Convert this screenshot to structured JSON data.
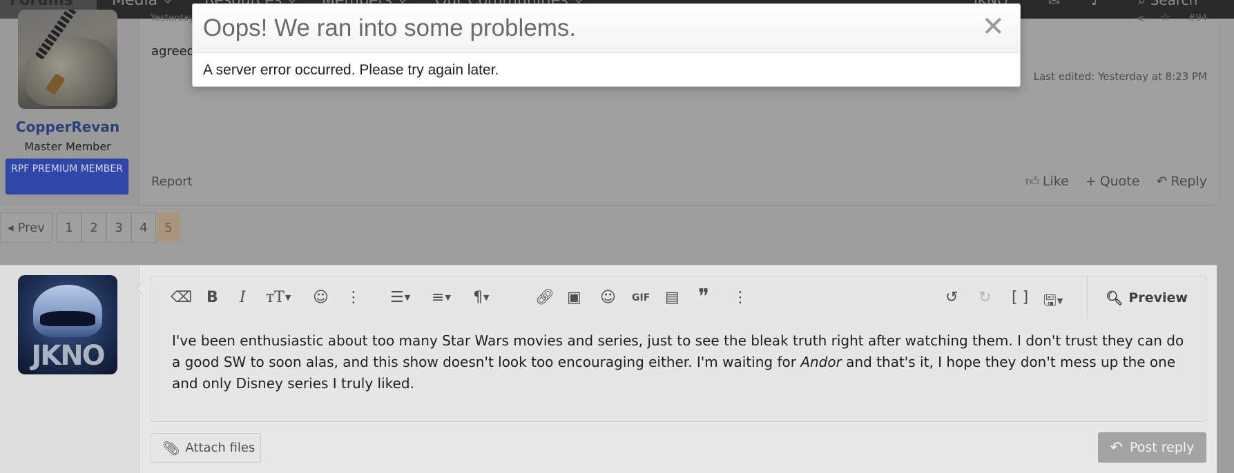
{
  "nav": {
    "tabs": [
      "Forums",
      "Media",
      "Resources",
      "Members",
      "Our Communities"
    ],
    "user": "JKNO",
    "search_label": "Search"
  },
  "post": {
    "username": "CopperRevan",
    "user_title": "Master Member",
    "badge": "RPF PREMIUM MEMBER",
    "timestamp": "Yesterday",
    "post_number": "#94",
    "content": "agreed",
    "last_edited": "Last edited: Yesterday at 8:23 PM",
    "report": "Report",
    "actions": {
      "like": "Like",
      "quote": "Quote",
      "reply": "Reply"
    }
  },
  "pagination": {
    "prev": "Prev",
    "pages": [
      "1",
      "2",
      "3",
      "4",
      "5"
    ],
    "current": "5"
  },
  "reply": {
    "avatar_text": "JKNO",
    "text_before": "I've been enthusiastic about too many Star Wars movies and series, just to see the bleak truth right after watching them. I don't trust they can do a good SW to soon alas, and this show doesn't look too encouraging either. I'm waiting for ",
    "text_italic": "Andor",
    "text_after": " and that's it, I hope they don't mess up the one and only Disney series I truly liked.",
    "preview_label": "Preview",
    "attach_label": "Attach files",
    "post_label": "Post reply",
    "toolbar_icons": [
      "eraser-icon",
      "bold-icon",
      "italic-icon",
      "text-size-icon",
      "color-palette-icon",
      "more-options-icon",
      "list-icon",
      "align-icon",
      "paragraph-icon",
      "link-icon",
      "image-icon",
      "emoji-icon",
      "gif-icon",
      "media-icon",
      "quote-icon",
      "more-insert-icon",
      "undo-icon",
      "redo-icon",
      "fullscreen-icon",
      "drafts-icon"
    ]
  },
  "modal": {
    "title": "Oops! We ran into some problems.",
    "message": "A server error occurred. Please try again later.",
    "close_glyph": "✕"
  }
}
